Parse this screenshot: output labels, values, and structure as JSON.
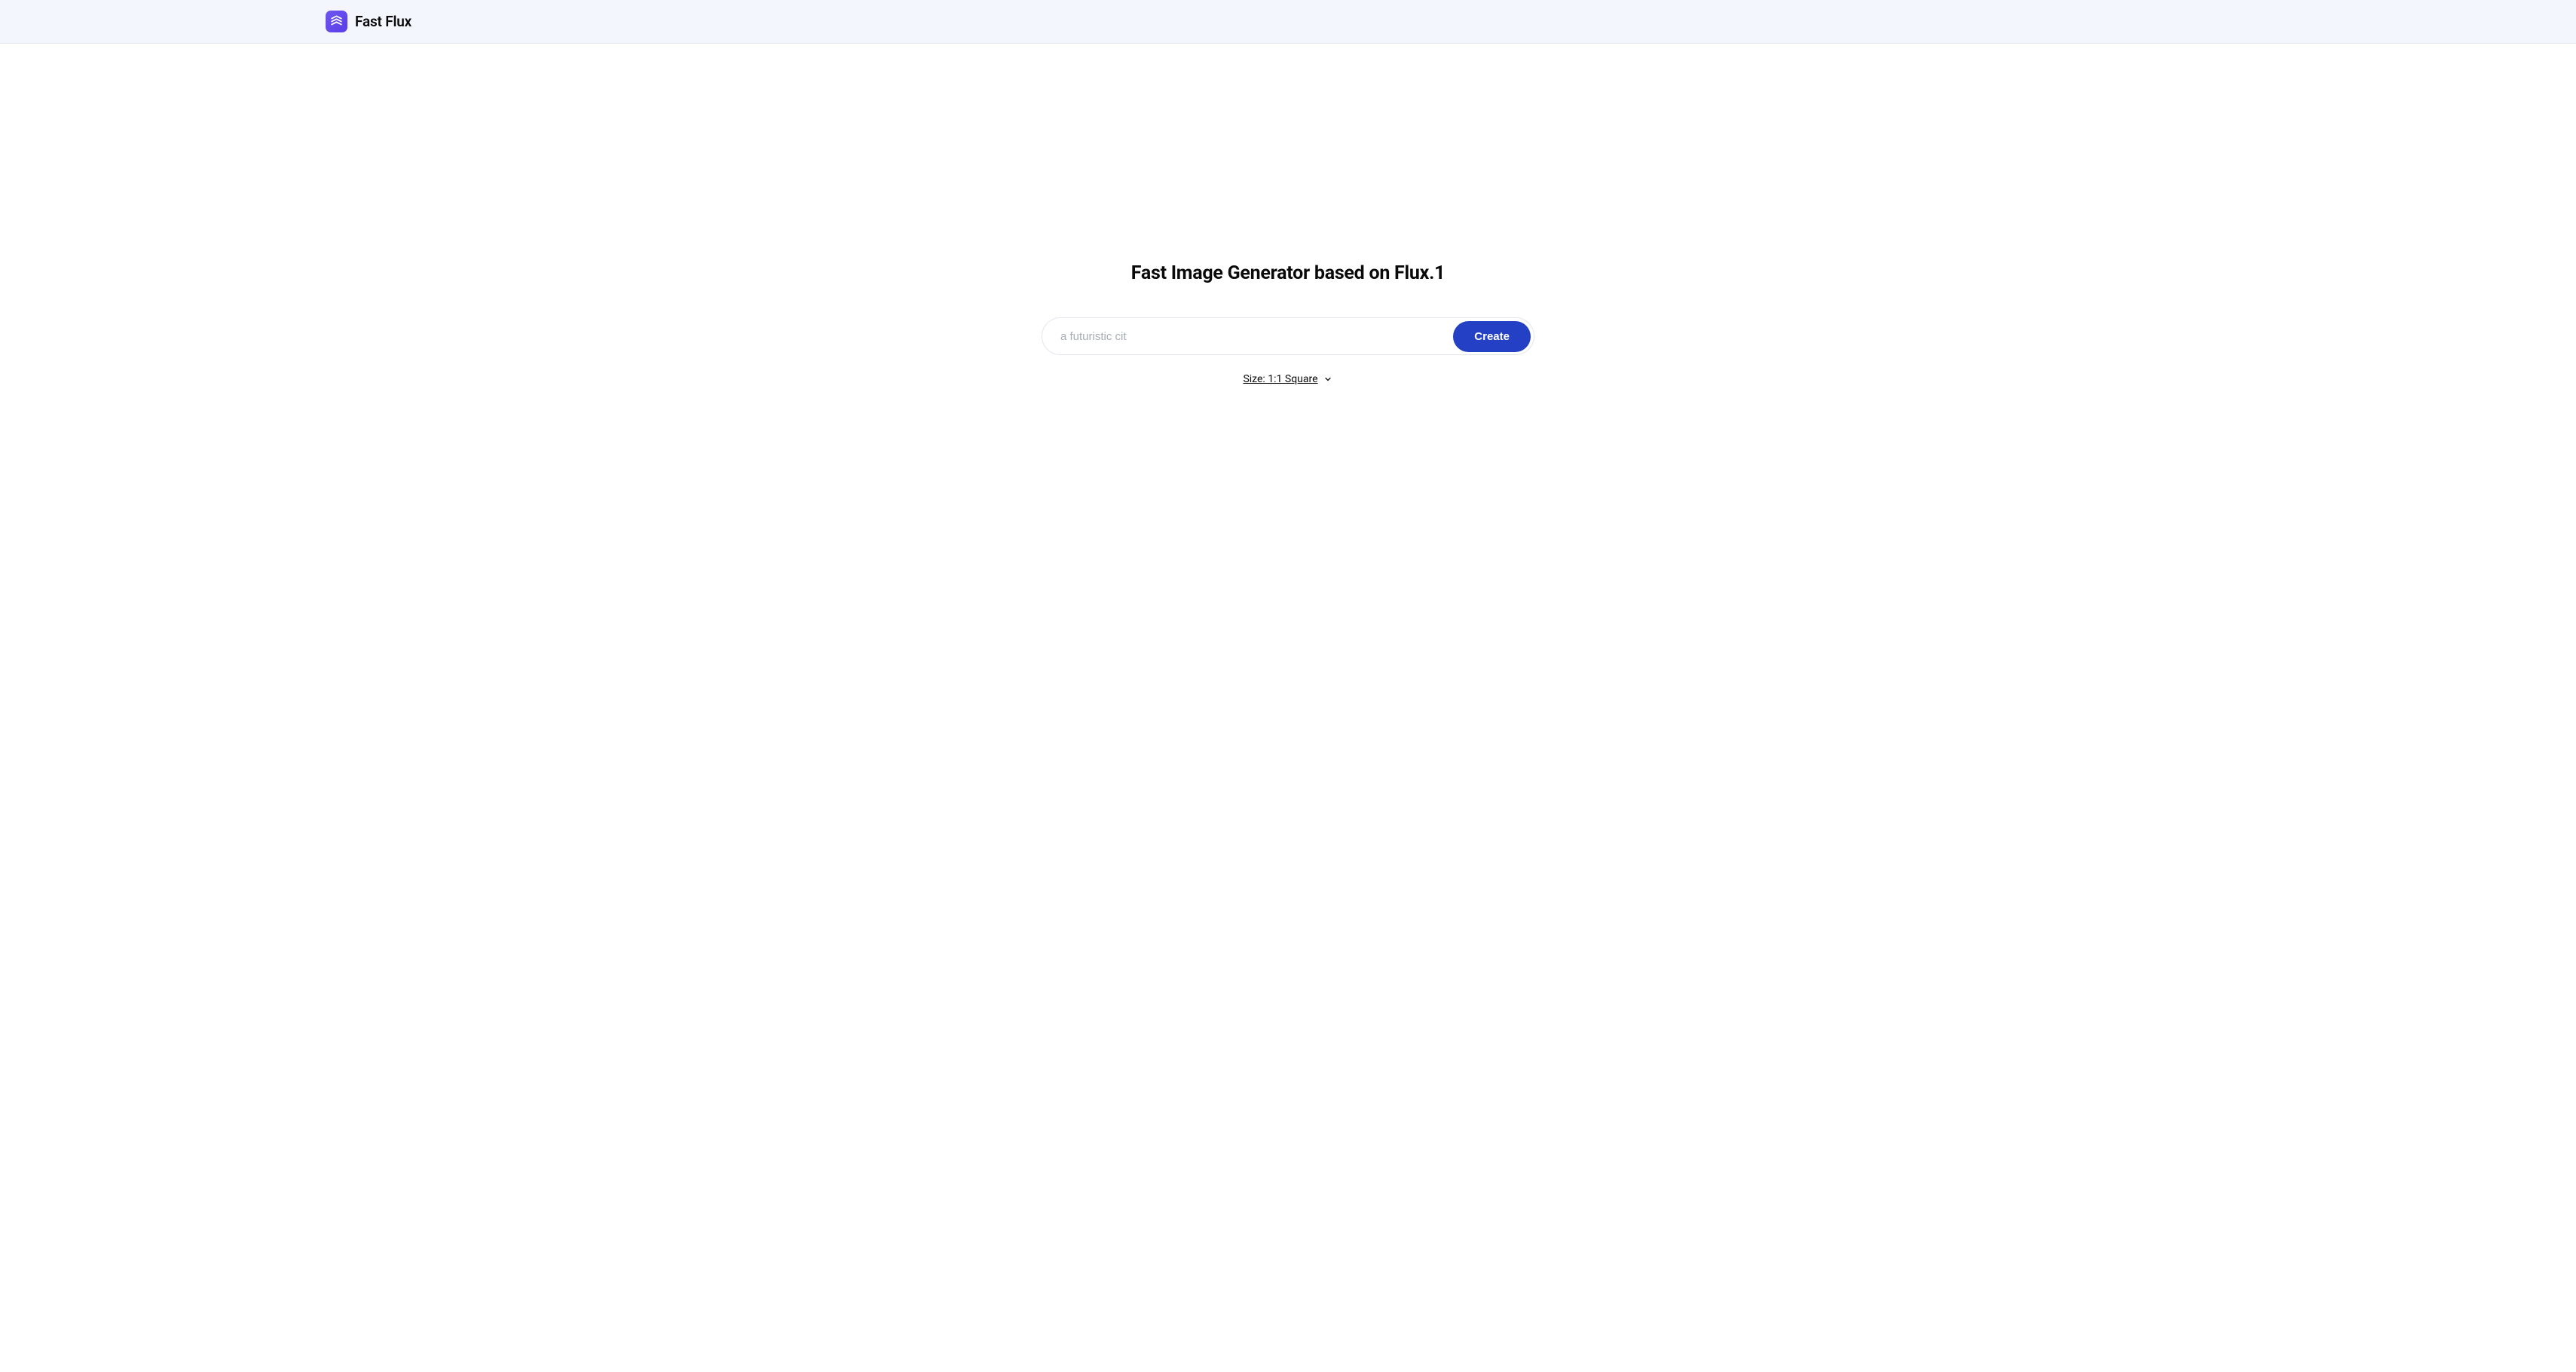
{
  "header": {
    "app_name": "Fast Flux"
  },
  "main": {
    "title": "Fast Image Generator based on Flux.1",
    "prompt_placeholder": "a futuristic cit",
    "prompt_value": "",
    "create_button_label": "Create",
    "size_selector": {
      "label": "Size: 1:1 Square"
    }
  },
  "colors": {
    "header_bg": "#f3f7fd",
    "logo_gradient_start": "#6d56f0",
    "logo_gradient_end": "#5b3de8",
    "button_bg": "#2440c5",
    "border": "#e2e5eb",
    "text_primary": "#0a0a0a",
    "placeholder": "#a8adb7"
  }
}
